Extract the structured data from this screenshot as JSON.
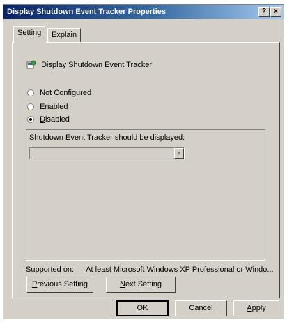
{
  "window": {
    "title": "Display Shutdown Event Tracker Properties",
    "help_button": "?",
    "close_button": "×"
  },
  "tabs": [
    {
      "label": "Setting",
      "active": true
    },
    {
      "label": "Explain",
      "active": false
    }
  ],
  "policy": {
    "icon": "policy-setting-icon",
    "name": "Display Shutdown Event Tracker"
  },
  "radio_options": [
    {
      "label": "Not Configured",
      "accel": "C",
      "before": "Not ",
      "after": "onfigured",
      "checked": false
    },
    {
      "label": "Enabled",
      "accel": "E",
      "before": "",
      "after": "nabled",
      "checked": false
    },
    {
      "label": "Disabled",
      "accel": "D",
      "before": "",
      "after": "isabled",
      "checked": true
    }
  ],
  "options": {
    "label": "Shutdown Event Tracker should be displayed:",
    "combo_value": ""
  },
  "supported": {
    "label": "Supported on:",
    "value": "At least Microsoft Windows XP Professional or Windo..."
  },
  "nav_buttons": {
    "previous": {
      "accel": "P",
      "rest": "revious Setting"
    },
    "next": {
      "accel": "N",
      "rest": "ext Setting"
    }
  },
  "dialog_buttons": {
    "ok": "OK",
    "cancel": "Cancel",
    "apply": {
      "accel": "A",
      "rest": "pply"
    }
  },
  "colors": {
    "title_bar": "#0a246a",
    "face": "#d4d0c8"
  }
}
